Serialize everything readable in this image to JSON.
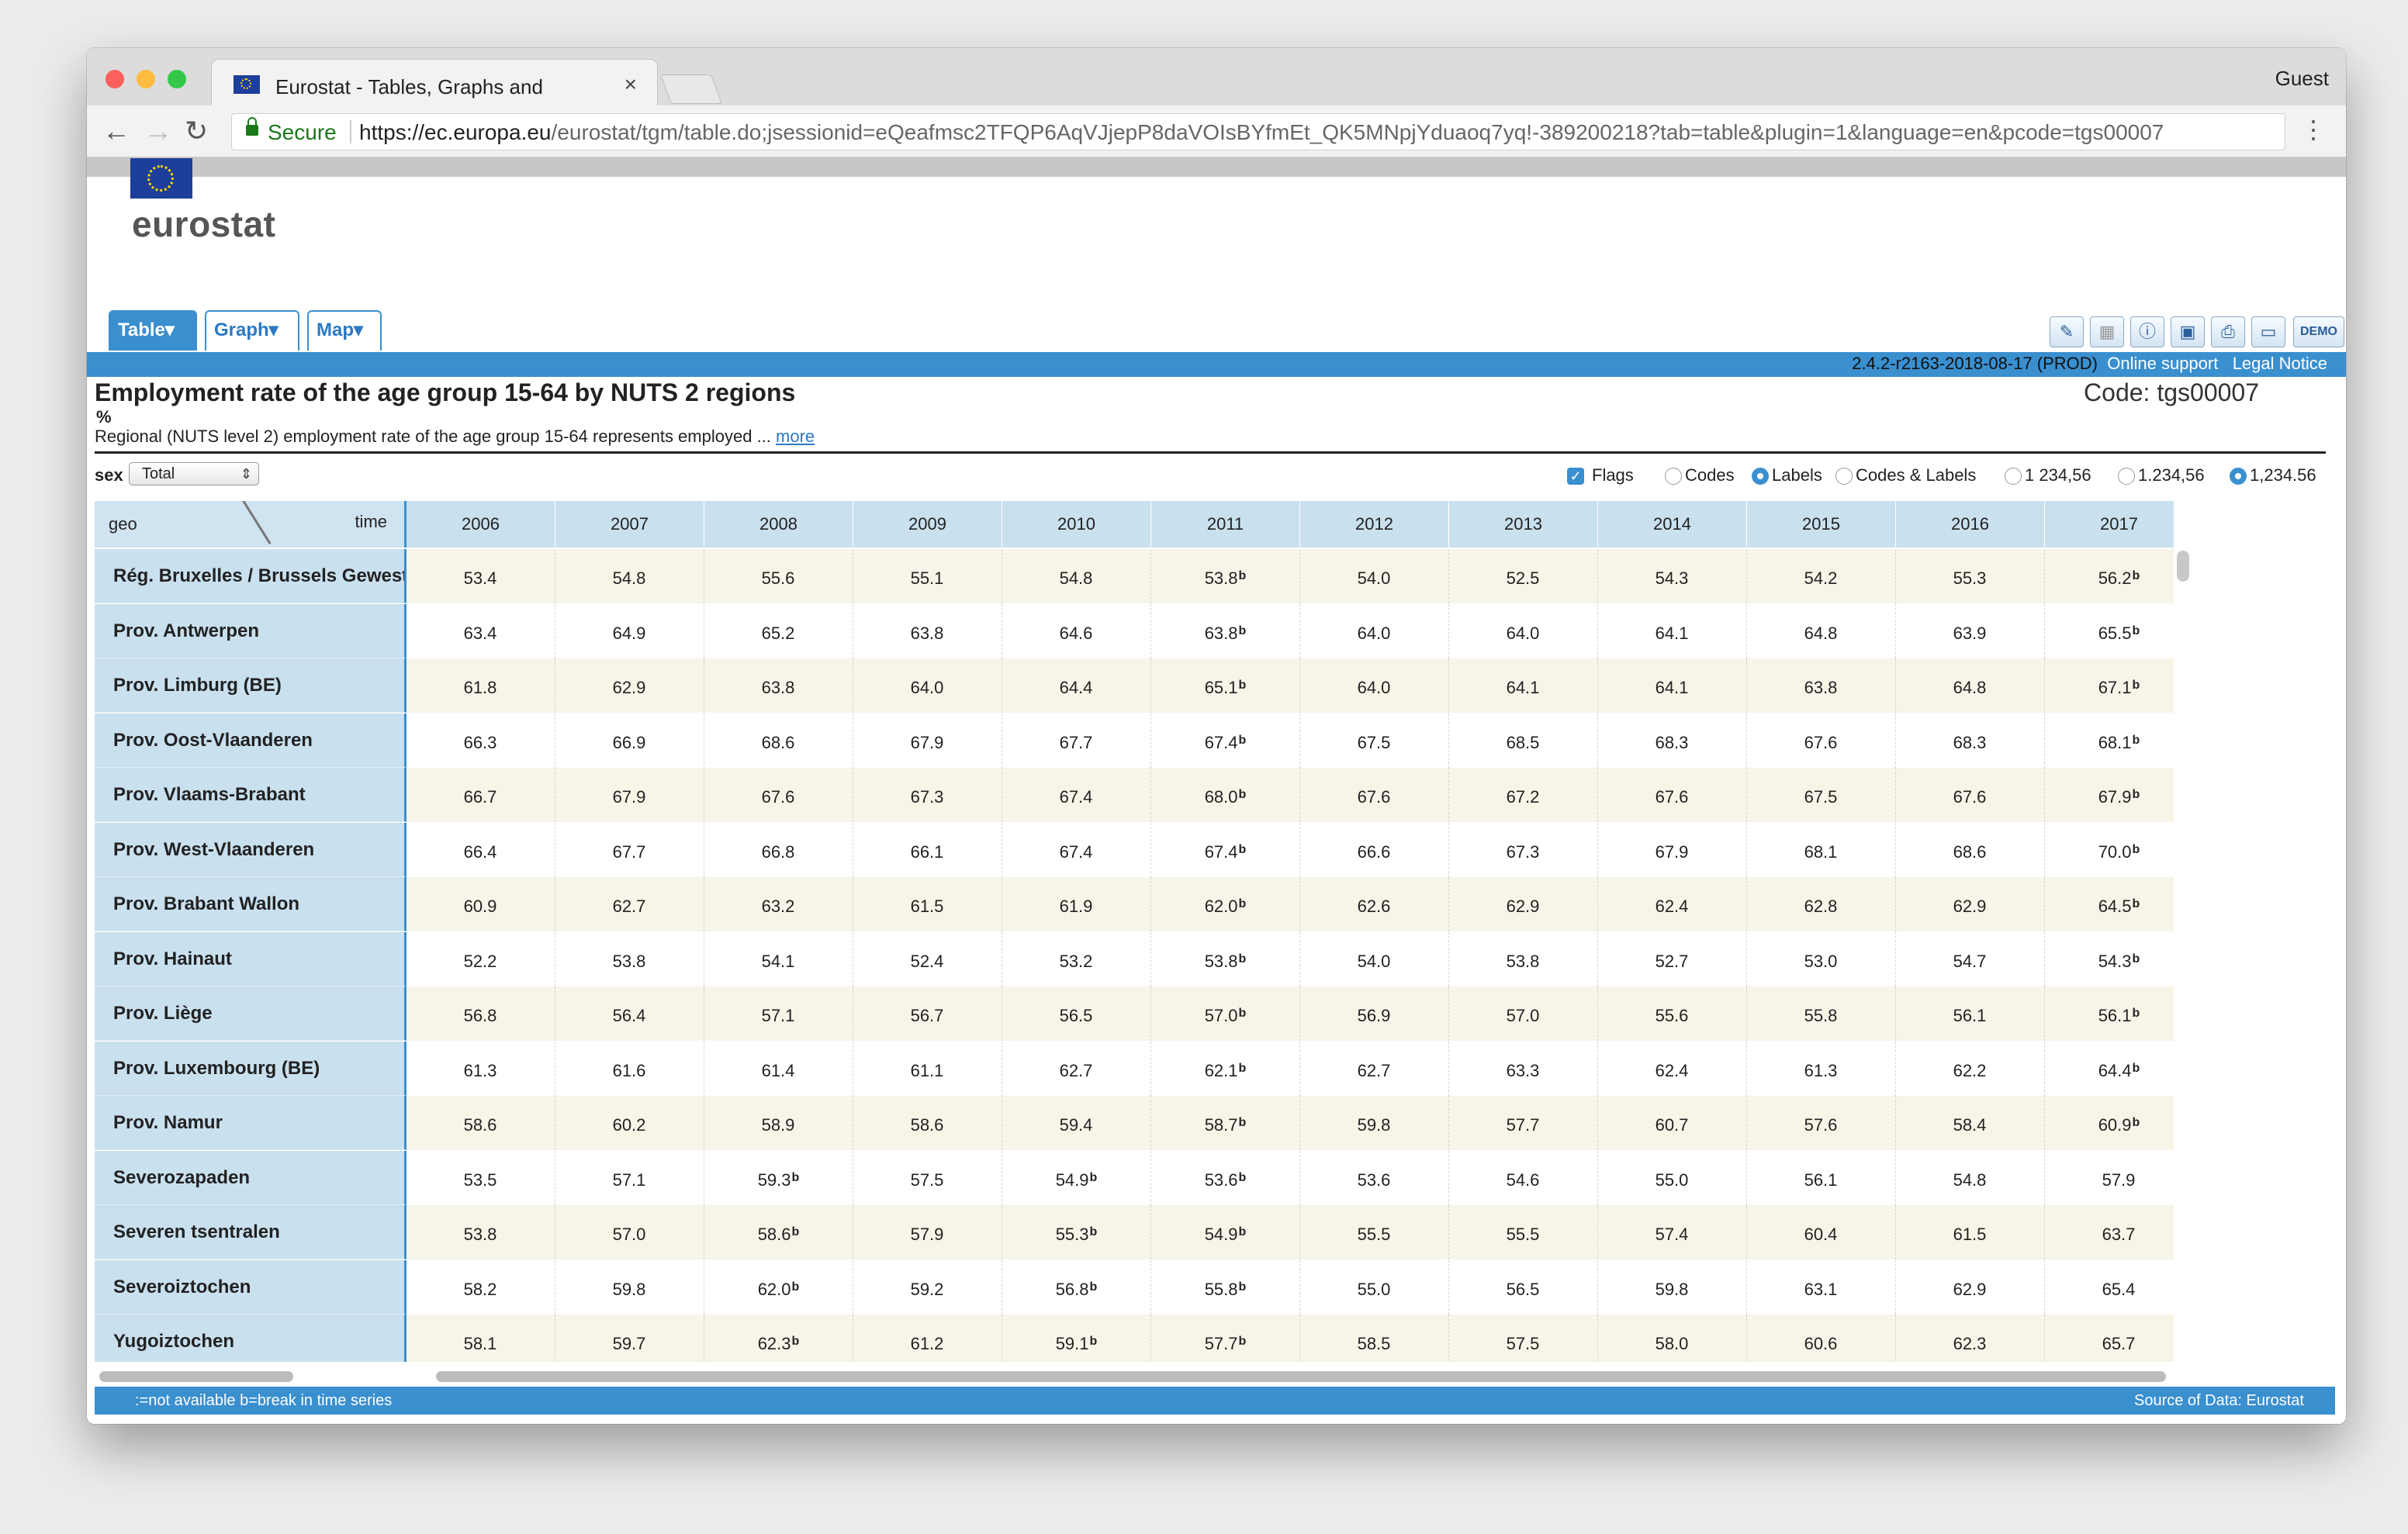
{
  "browser": {
    "tab_title": "Eurostat - Tables, Graphs and",
    "close_glyph": "×",
    "user": "Guest",
    "secure_label": "Secure",
    "url_host": "https://ec.europa.eu",
    "url_path": "/eurostat/tgm/table.do;jsessionid=eQeafmsc2TFQP6AqVJjepP8daVOIsBYfmEt_QK5MNpjYduaoq7yq!-389200218?tab=table&plugin=1&language=en&pcode=tgs00007"
  },
  "header": {
    "brand": "eurostat",
    "tabs": [
      {
        "label": "Table▾"
      },
      {
        "label": "Graph▾"
      },
      {
        "label": "Map▾"
      }
    ],
    "toolbar_icons": [
      "edit-icon",
      "layout-icon",
      "info-icon",
      "save-icon",
      "print-icon",
      "folder-icon"
    ],
    "demo_label": "DEMO",
    "version": "2.4.2-r2163-2018-08-17 (PROD)",
    "online_support": "Online support",
    "legal_notice": "Legal Notice"
  },
  "table_info": {
    "title": "Employment rate of the age group 15-64 by NUTS 2 regions",
    "unit": "%",
    "description": "Regional (NUTS level 2) employment rate of the age group 15-64 represents employed ...",
    "more_link": "more",
    "code": "Code: tgs00007"
  },
  "filters": {
    "sex_label": "sex",
    "sex_value": "Total",
    "flags_label": "Flags",
    "codes_label": "Codes",
    "labels_label": "Labels",
    "codes_labels_label": "Codes & Labels",
    "fmt1": "1 234,56",
    "fmt2": "1.234,56",
    "fmt3": "1,234.56"
  },
  "grid": {
    "geo_header": "geo",
    "time_header": "time",
    "years": [
      "2006",
      "2007",
      "2008",
      "2009",
      "2010",
      "2011",
      "2012",
      "2013",
      "2014",
      "2015",
      "2016",
      "2017"
    ],
    "rows": [
      {
        "geo": "Rég. Bruxelles / Brussels Gewest",
        "values": [
          "53.4",
          "54.8",
          "55.6",
          "55.1",
          "54.8",
          "53.8",
          "54.0",
          "52.5",
          "54.3",
          "54.2",
          "55.3",
          "56.2"
        ],
        "flags": [
          "",
          "",
          "",
          "",
          "",
          "b",
          "",
          "",
          "",
          "",
          "",
          "b"
        ]
      },
      {
        "geo": "Prov. Antwerpen",
        "values": [
          "63.4",
          "64.9",
          "65.2",
          "63.8",
          "64.6",
          "63.8",
          "64.0",
          "64.0",
          "64.1",
          "64.8",
          "63.9",
          "65.5"
        ],
        "flags": [
          "",
          "",
          "",
          "",
          "",
          "b",
          "",
          "",
          "",
          "",
          "",
          "b"
        ]
      },
      {
        "geo": "Prov. Limburg (BE)",
        "values": [
          "61.8",
          "62.9",
          "63.8",
          "64.0",
          "64.4",
          "65.1",
          "64.0",
          "64.1",
          "64.1",
          "63.8",
          "64.8",
          "67.1"
        ],
        "flags": [
          "",
          "",
          "",
          "",
          "",
          "b",
          "",
          "",
          "",
          "",
          "",
          "b"
        ]
      },
      {
        "geo": "Prov. Oost-Vlaanderen",
        "values": [
          "66.3",
          "66.9",
          "68.6",
          "67.9",
          "67.7",
          "67.4",
          "67.5",
          "68.5",
          "68.3",
          "67.6",
          "68.3",
          "68.1"
        ],
        "flags": [
          "",
          "",
          "",
          "",
          "",
          "b",
          "",
          "",
          "",
          "",
          "",
          "b"
        ]
      },
      {
        "geo": "Prov. Vlaams-Brabant",
        "values": [
          "66.7",
          "67.9",
          "67.6",
          "67.3",
          "67.4",
          "68.0",
          "67.6",
          "67.2",
          "67.6",
          "67.5",
          "67.6",
          "67.9"
        ],
        "flags": [
          "",
          "",
          "",
          "",
          "",
          "b",
          "",
          "",
          "",
          "",
          "",
          "b"
        ]
      },
      {
        "geo": "Prov. West-Vlaanderen",
        "values": [
          "66.4",
          "67.7",
          "66.8",
          "66.1",
          "67.4",
          "67.4",
          "66.6",
          "67.3",
          "67.9",
          "68.1",
          "68.6",
          "70.0"
        ],
        "flags": [
          "",
          "",
          "",
          "",
          "",
          "b",
          "",
          "",
          "",
          "",
          "",
          "b"
        ]
      },
      {
        "geo": "Prov. Brabant Wallon",
        "values": [
          "60.9",
          "62.7",
          "63.2",
          "61.5",
          "61.9",
          "62.0",
          "62.6",
          "62.9",
          "62.4",
          "62.8",
          "62.9",
          "64.5"
        ],
        "flags": [
          "",
          "",
          "",
          "",
          "",
          "b",
          "",
          "",
          "",
          "",
          "",
          "b"
        ]
      },
      {
        "geo": "Prov. Hainaut",
        "values": [
          "52.2",
          "53.8",
          "54.1",
          "52.4",
          "53.2",
          "53.8",
          "54.0",
          "53.8",
          "52.7",
          "53.0",
          "54.7",
          "54.3"
        ],
        "flags": [
          "",
          "",
          "",
          "",
          "",
          "b",
          "",
          "",
          "",
          "",
          "",
          "b"
        ]
      },
      {
        "geo": "Prov. Liège",
        "values": [
          "56.8",
          "56.4",
          "57.1",
          "56.7",
          "56.5",
          "57.0",
          "56.9",
          "57.0",
          "55.6",
          "55.8",
          "56.1",
          "56.1"
        ],
        "flags": [
          "",
          "",
          "",
          "",
          "",
          "b",
          "",
          "",
          "",
          "",
          "",
          "b"
        ]
      },
      {
        "geo": "Prov. Luxembourg (BE)",
        "values": [
          "61.3",
          "61.6",
          "61.4",
          "61.1",
          "62.7",
          "62.1",
          "62.7",
          "63.3",
          "62.4",
          "61.3",
          "62.2",
          "64.4"
        ],
        "flags": [
          "",
          "",
          "",
          "",
          "",
          "b",
          "",
          "",
          "",
          "",
          "",
          "b"
        ]
      },
      {
        "geo": "Prov. Namur",
        "values": [
          "58.6",
          "60.2",
          "58.9",
          "58.6",
          "59.4",
          "58.7",
          "59.8",
          "57.7",
          "60.7",
          "57.6",
          "58.4",
          "60.9"
        ],
        "flags": [
          "",
          "",
          "",
          "",
          "",
          "b",
          "",
          "",
          "",
          "",
          "",
          "b"
        ]
      },
      {
        "geo": "Severozapaden",
        "values": [
          "53.5",
          "57.1",
          "59.3",
          "57.5",
          "54.9",
          "53.6",
          "53.6",
          "54.6",
          "55.0",
          "56.1",
          "54.8",
          "57.9"
        ],
        "flags": [
          "",
          "",
          "b",
          "",
          "b",
          "b",
          "",
          "",
          "",
          "",
          "",
          ""
        ]
      },
      {
        "geo": "Severen tsentralen",
        "values": [
          "53.8",
          "57.0",
          "58.6",
          "57.9",
          "55.3",
          "54.9",
          "55.5",
          "55.5",
          "57.4",
          "60.4",
          "61.5",
          "63.7"
        ],
        "flags": [
          "",
          "",
          "b",
          "",
          "b",
          "b",
          "",
          "",
          "",
          "",
          "",
          ""
        ]
      },
      {
        "geo": "Severoiztochen",
        "values": [
          "58.2",
          "59.8",
          "62.0",
          "59.2",
          "56.8",
          "55.8",
          "55.0",
          "56.5",
          "59.8",
          "63.1",
          "62.9",
          "65.4"
        ],
        "flags": [
          "",
          "",
          "b",
          "",
          "b",
          "b",
          "",
          "",
          "",
          "",
          "",
          ""
        ]
      },
      {
        "geo": "Yugoiztochen",
        "values": [
          "58.1",
          "59.7",
          "62.3",
          "61.2",
          "59.1",
          "57.7",
          "58.5",
          "57.5",
          "58.0",
          "60.6",
          "62.3",
          "65.7"
        ],
        "flags": [
          "",
          "",
          "b",
          "",
          "b",
          "b",
          "",
          "",
          "",
          "",
          "",
          ""
        ]
      }
    ]
  },
  "footer": {
    "legend": ":=not available b=break in time series",
    "source": "Source of Data: Eurostat"
  }
}
